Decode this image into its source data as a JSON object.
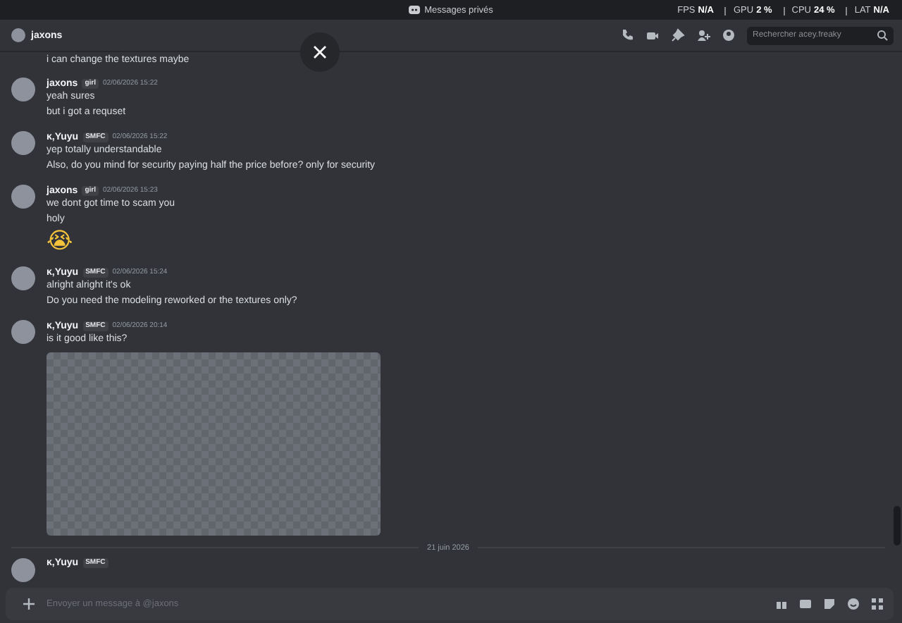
{
  "titlebar": {
    "title": "Messages privés",
    "stats": [
      {
        "label": "FPS",
        "value": "N/A"
      },
      {
        "label": "GPU",
        "value": "2 %"
      },
      {
        "label": "CPU",
        "value": "24 %"
      },
      {
        "label": "LAT",
        "value": "N/A"
      }
    ]
  },
  "header": {
    "name": "jaxons",
    "search": {
      "placeholder": "Rechercher acey.freaky"
    }
  },
  "partial_message": "i can change the textures maybe",
  "messages": [
    {
      "author": "jaxons",
      "tag": "girl",
      "time": "02/06/2026 15:22",
      "lines": [
        {
          "kind": "text",
          "text": "yeah  sures"
        },
        {
          "kind": "text",
          "text": "but i got a requset"
        }
      ]
    },
    {
      "author": "ĸ,Yuyu",
      "tag": "SMFC",
      "time": "02/06/2026 15:22",
      "lines": [
        {
          "kind": "text",
          "text": "yep totally understandable"
        },
        {
          "kind": "text",
          "text": "Also, do you mind for security paying half the price before? only for security"
        }
      ]
    },
    {
      "author": "jaxons",
      "tag": "girl",
      "time": "02/06/2026 15:23",
      "lines": [
        {
          "kind": "text",
          "text": "we dont got time to scam you"
        },
        {
          "kind": "text",
          "text": "holy"
        },
        {
          "kind": "emoji",
          "text": "😭"
        }
      ]
    },
    {
      "author": "ĸ,Yuyu",
      "tag": "SMFC",
      "time": "02/06/2026 15:24",
      "lines": [
        {
          "kind": "text",
          "text": "alright alright  it's ok"
        },
        {
          "kind": "text",
          "text": "Do you need the modeling reworked or the textures only?"
        }
      ]
    },
    {
      "author": "ĸ,Yuyu",
      "tag": "SMFC",
      "time": "02/06/2026 20:14",
      "lines": [
        {
          "kind": "text",
          "text": "is it good like this?"
        },
        {
          "kind": "image"
        }
      ]
    }
  ],
  "date_divider": "21 juin 2026",
  "cut_message": {
    "author": "ĸ,Yuyu",
    "tag": "SMFC"
  },
  "composer": {
    "placeholder": "Envoyer un message à @jaxons"
  }
}
